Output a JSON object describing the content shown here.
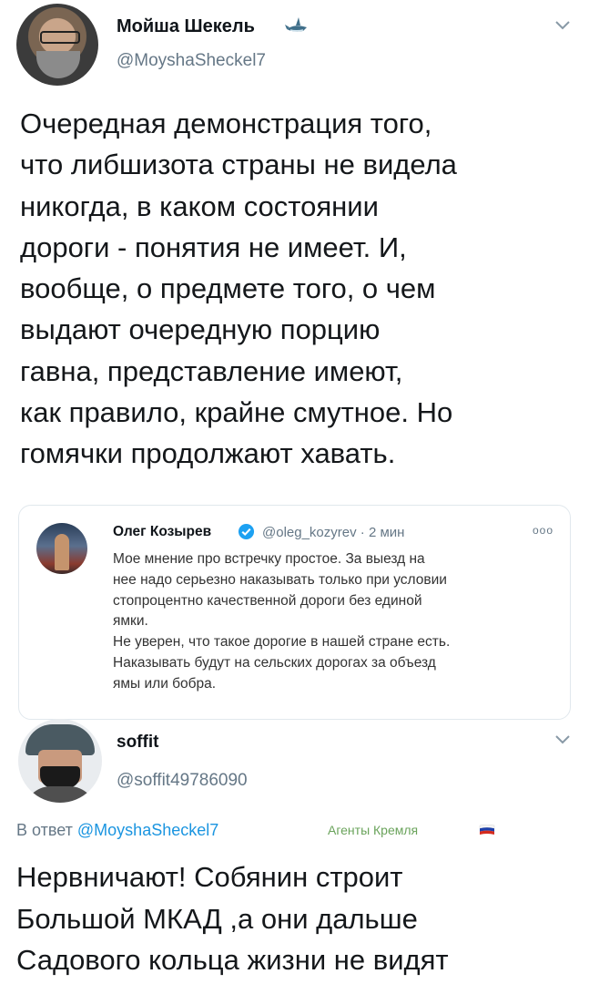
{
  "tweet": {
    "author_name": "Мойша Шекель",
    "author_handle": "@MoyshaSheckel7",
    "text": "Очередная демонстрация того,\nчто либшизота страны не видела\nникогда, в каком состоянии\nдороги - понятия не имеет. И,\nвообще, о предмете того, о чем\nвыдают очередную порцию\nгавна, представление имеют,\nкак правило, крайне смутное. Но\nгомячки продолжают хавать."
  },
  "quoted_tweet": {
    "author_name": "Олег Козырев",
    "author_handle": "@oleg_kozyrev",
    "separator": "·",
    "time": "2 мин",
    "more": "ooo",
    "text": "Мое мнение про встречку простое. За выезд на\nнее надо серьезно наказывать только при условии\nстопроцентно качественной дороги без единой\nямки.\nНе уверен, что такое дорогие в нашей стране есть.\nНаказывать будут на сельских дорогах за объезд\nямы или  бобра."
  },
  "reply": {
    "author_name": "soffit",
    "author_handle": "@soffit49786090",
    "reply_prefix": "В ответ",
    "reply_to": "@MoyshaSheckel7",
    "watermark": "Агенты Кремля",
    "text": "Нервничают! Собянин строит\nБольшой  МКАД ,а они дальше\nСадового кольца жизни не видят"
  },
  "icons": {
    "menu": "chevron-down-icon",
    "shark": "shark-emoji-icon",
    "verified": "verified-badge-icon",
    "flag": "russia-flag-icon"
  },
  "colors": {
    "text": "#14171a",
    "secondary": "#657786",
    "link": "#1b95e0",
    "verified": "#1da1f2",
    "border": "#e1e8ed",
    "watermark": "#6aa35b"
  }
}
